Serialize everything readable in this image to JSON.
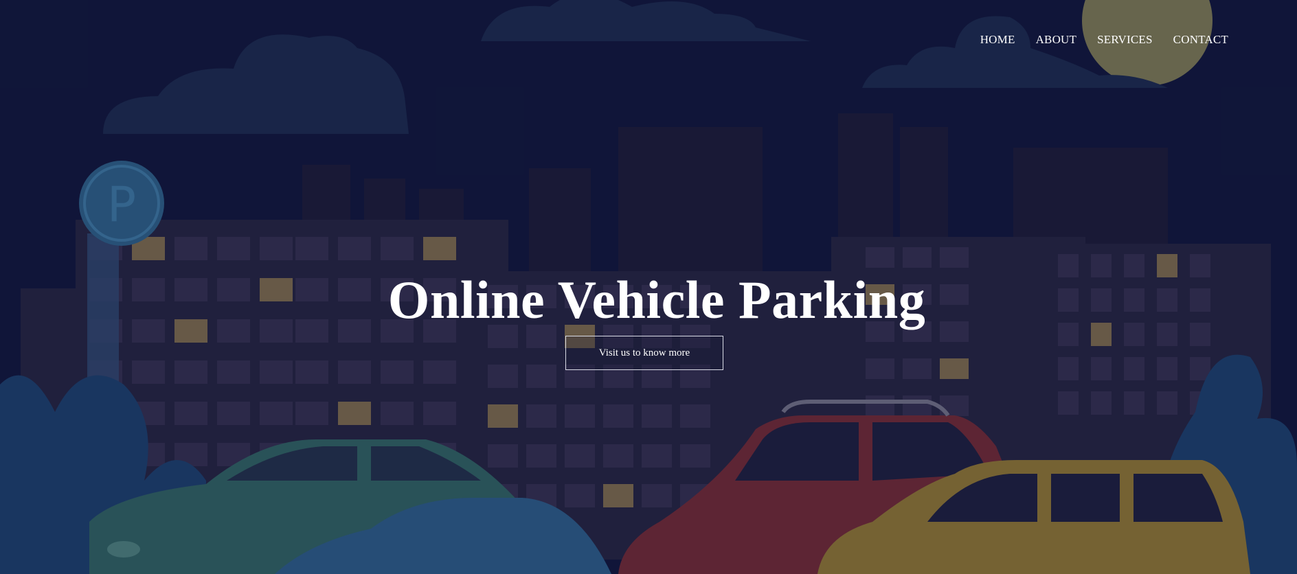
{
  "nav": {
    "items": [
      {
        "label": "HOME"
      },
      {
        "label": "ABOUT"
      },
      {
        "label": "SERVICES"
      },
      {
        "label": "CONTACT"
      }
    ]
  },
  "hero": {
    "title": "Online Vehicle Parking",
    "cta_label": "Visit us to know more"
  },
  "scene": {
    "sign_letter": "P",
    "colors": {
      "sky": "#11173a",
      "cloud": "#1b2a4d",
      "moon": "#8d8a58",
      "building": "#262540",
      "window": "#322f4f",
      "window_lit": "#7a6a4c",
      "sign": "#2d5f86",
      "car_green": "#2f6161",
      "car_blue": "#2b5b86",
      "car_red": "#6e2a35",
      "car_yellow": "#8c7434",
      "plant": "#1c3f6b",
      "text": "#ffffff"
    }
  }
}
